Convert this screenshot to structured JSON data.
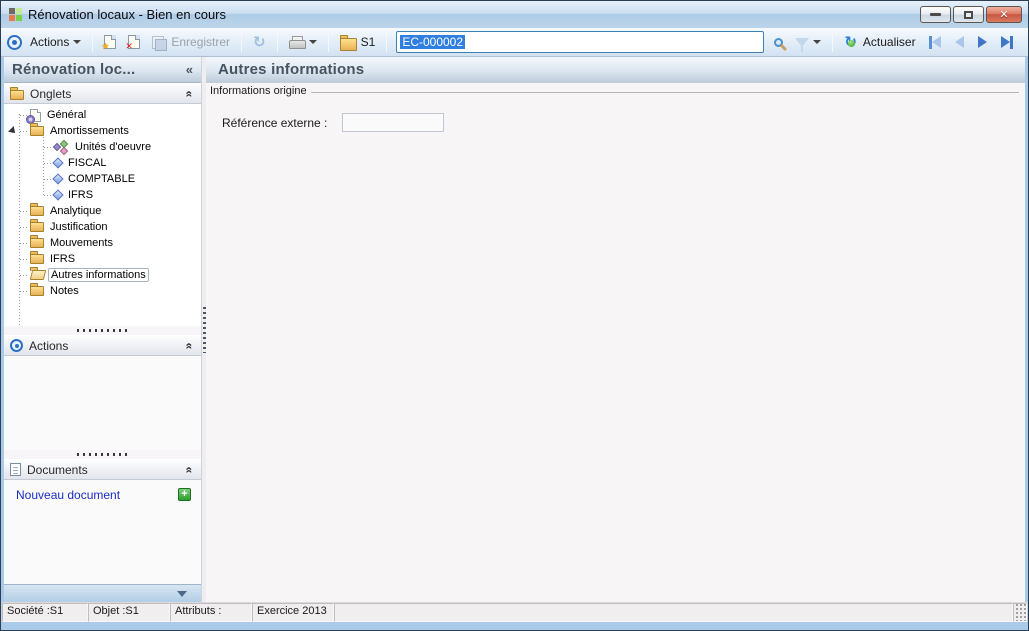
{
  "window": {
    "title": "Rénovation locaux -  Bien en cours"
  },
  "toolbar": {
    "actions_label": "Actions",
    "save_label": "Enregistrer",
    "folder_label": "S1",
    "reference_value": "EC-000002",
    "refresh_label": "Actualiser"
  },
  "sidebar": {
    "title": "Rénovation loc...",
    "collapse_glyph": "«",
    "chevron_glyph": "«",
    "panels": {
      "onglets": {
        "label": "Onglets"
      },
      "actions": {
        "label": "Actions"
      },
      "documents": {
        "label": "Documents",
        "link_label": "Nouveau document"
      }
    },
    "tree": [
      {
        "label": "Général",
        "icon": "page-gear",
        "level": 0
      },
      {
        "label": "Amortissements",
        "icon": "folder",
        "level": 0,
        "expanded": true
      },
      {
        "label": "Unités d'oeuvre",
        "icon": "diamonds",
        "level": 1
      },
      {
        "label": "FISCAL",
        "icon": "diamond",
        "level": 1
      },
      {
        "label": "COMPTABLE",
        "icon": "diamond",
        "level": 1
      },
      {
        "label": "IFRS",
        "icon": "diamond",
        "level": 1
      },
      {
        "label": "Analytique",
        "icon": "folder",
        "level": 0
      },
      {
        "label": "Justification",
        "icon": "folder",
        "level": 0
      },
      {
        "label": "Mouvements",
        "icon": "folder",
        "level": 0
      },
      {
        "label": "IFRS",
        "icon": "folder",
        "level": 0
      },
      {
        "label": "Autres informations",
        "icon": "folder-open",
        "level": 0,
        "selected": true
      },
      {
        "label": "Notes",
        "icon": "folder",
        "level": 0
      }
    ]
  },
  "main": {
    "title": "Autres informations",
    "fieldset_legend": "Informations origine",
    "reference_label": "Référence externe :",
    "reference_value": ""
  },
  "statusbar": {
    "cells": [
      "Société :S1",
      "Objet :S1",
      "Attributs :",
      "Exercice 2013"
    ]
  },
  "colors": {
    "selection_blue": "#2f7fe0",
    "link_blue": "#1a2cc8",
    "plus_green": "#2e9e2e",
    "close_red": "#c85743",
    "folder_yellow": "#e8b258"
  }
}
